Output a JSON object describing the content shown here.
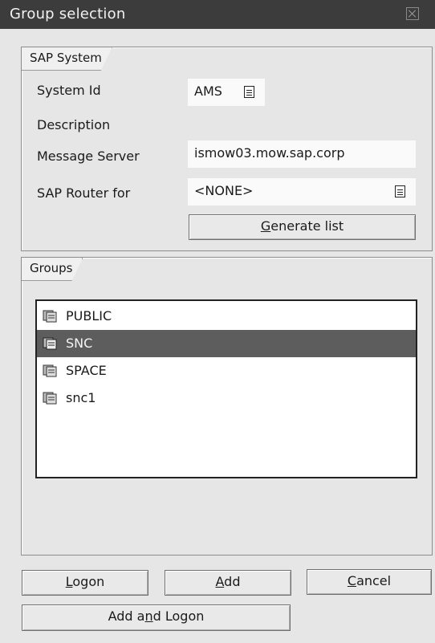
{
  "window": {
    "title": "Group selection"
  },
  "sap_system": {
    "section_label": "SAP System",
    "system_id_label": "System Id",
    "system_id_value": "AMS",
    "description_label": "Description",
    "message_server_label": "Message Server",
    "message_server_value": "ismow03.mow.sap.corp",
    "router_label": "SAP Router for",
    "router_value": "<NONE>",
    "generate_prefix": "",
    "generate_hotkey": "G",
    "generate_rest": "enerate list"
  },
  "groups": {
    "section_label": "Groups",
    "items": [
      {
        "label": "PUBLIC",
        "selected": false
      },
      {
        "label": "SNC",
        "selected": true
      },
      {
        "label": "SPACE",
        "selected": false
      },
      {
        "label": "snc1",
        "selected": false
      }
    ]
  },
  "buttons": {
    "logon": {
      "hotkey": "L",
      "rest": "ogon"
    },
    "add": {
      "hotkey": "A",
      "rest": "dd"
    },
    "cancel": {
      "hotkey": "C",
      "rest": "ancel"
    },
    "add_and_logon": {
      "pre": "Add a",
      "hotkey": "n",
      "post": "d Logon"
    }
  },
  "icons": {
    "value_help": "value-help-icon",
    "group": "server-group-icon",
    "close": "close-icon"
  }
}
